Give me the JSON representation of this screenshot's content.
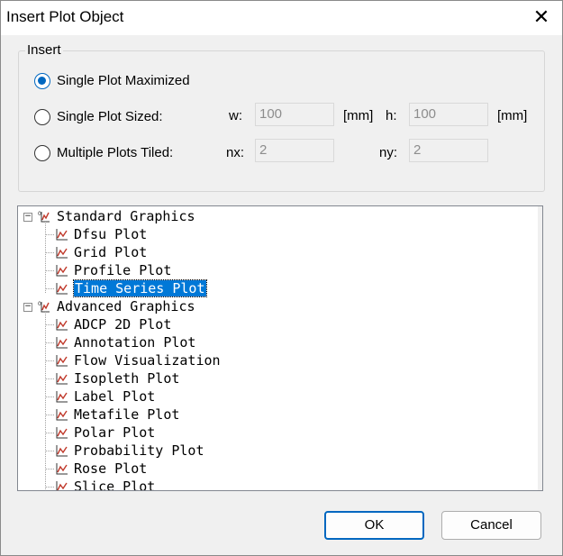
{
  "window": {
    "title": "Insert Plot Object",
    "close_symbol": "✕"
  },
  "group": {
    "label": "Insert",
    "options": [
      {
        "label": "Single Plot Maximized",
        "checked": true
      },
      {
        "label": "Single Plot Sized:",
        "checked": false
      },
      {
        "label": "Multiple Plots Tiled:",
        "checked": false
      }
    ]
  },
  "sized": {
    "w_label": "w:",
    "w_value": "100",
    "w_unit": "[mm]",
    "h_label": "h:",
    "h_value": "100",
    "h_unit": "[mm]"
  },
  "tiled": {
    "nx_label": "nx:",
    "nx_value": "2",
    "ny_label": "ny:",
    "ny_value": "2"
  },
  "tree": {
    "groups": [
      {
        "label": "Standard Graphics",
        "expander": "−",
        "items": [
          "Dfsu Plot",
          "Grid Plot",
          "Profile Plot",
          "Time Series Plot"
        ]
      },
      {
        "label": "Advanced Graphics",
        "expander": "−",
        "items": [
          "ADCP 2D Plot",
          "Annotation Plot",
          "Flow Visualization",
          "Isopleth Plot",
          "Label Plot",
          "Metafile Plot",
          "Polar Plot",
          "Probability Plot",
          "Rose Plot",
          "Slice Plot"
        ]
      }
    ],
    "selected": "Time Series Plot"
  },
  "buttons": {
    "ok": "OK",
    "cancel": "Cancel"
  },
  "colors": {
    "accent": "#0067c0",
    "selection": "#0078d7",
    "icon": "#c0392b"
  }
}
